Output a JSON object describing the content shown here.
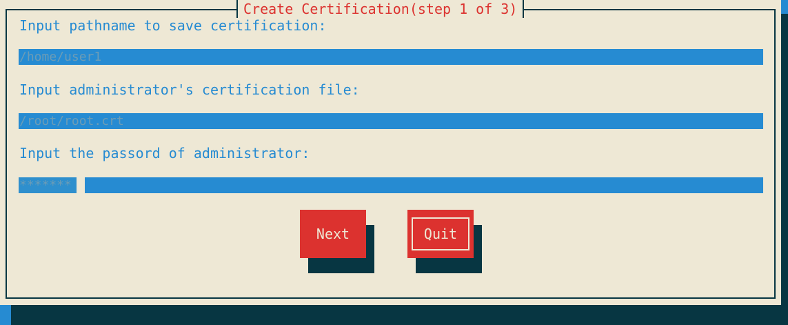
{
  "dialog": {
    "title": "Create Certification(step 1 of 3)"
  },
  "fields": {
    "pathname": {
      "label": "Input pathname to save certification:",
      "value": "/home/user1"
    },
    "admin_cert": {
      "label": "Input administrator's certification file:",
      "value": "/root/root.crt"
    },
    "admin_password": {
      "label": "Input the passord of administrator:",
      "value": "*******"
    }
  },
  "buttons": {
    "next": "Next",
    "quit": "Quit"
  },
  "colors": {
    "background": "#268bd2",
    "dialog": "#eee8d5",
    "text": "#268bd2",
    "title": "#dc322f",
    "button": "#dc322f",
    "shadow": "#073642"
  }
}
